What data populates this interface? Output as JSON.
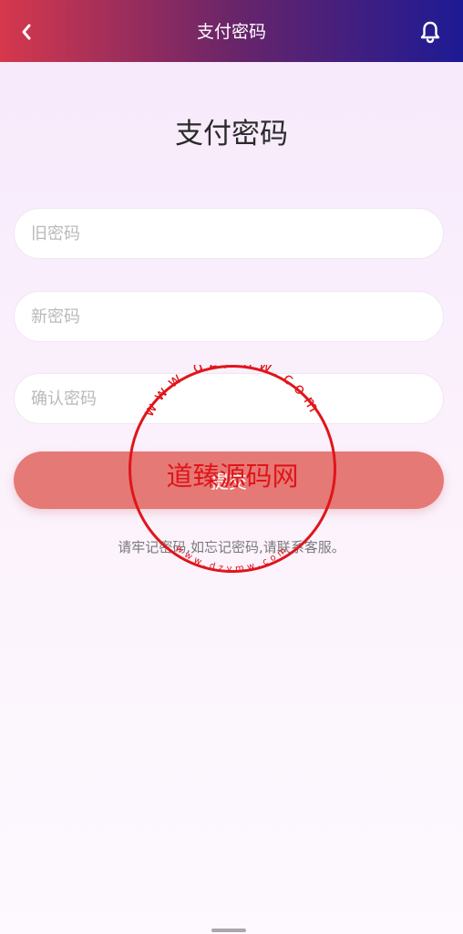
{
  "header": {
    "title": "支付密码",
    "back_icon": "chevron-left-icon",
    "bell_icon": "bell-icon"
  },
  "page": {
    "title": "支付密码"
  },
  "form": {
    "old_password_placeholder": "旧密码",
    "new_password_placeholder": "新密码",
    "confirm_password_placeholder": "确认密码",
    "submit_label": "提交",
    "hint": "请牢记密码,如忘记密码,请联系客服。"
  },
  "watermark": {
    "text": "道臻源码网",
    "url_text": "www.dzymw.com"
  },
  "colors": {
    "header_gradient_start": "#d6384c",
    "header_gradient_end": "#1d1a94",
    "submit_button": "#e57975",
    "watermark_red": "#e0151b"
  }
}
